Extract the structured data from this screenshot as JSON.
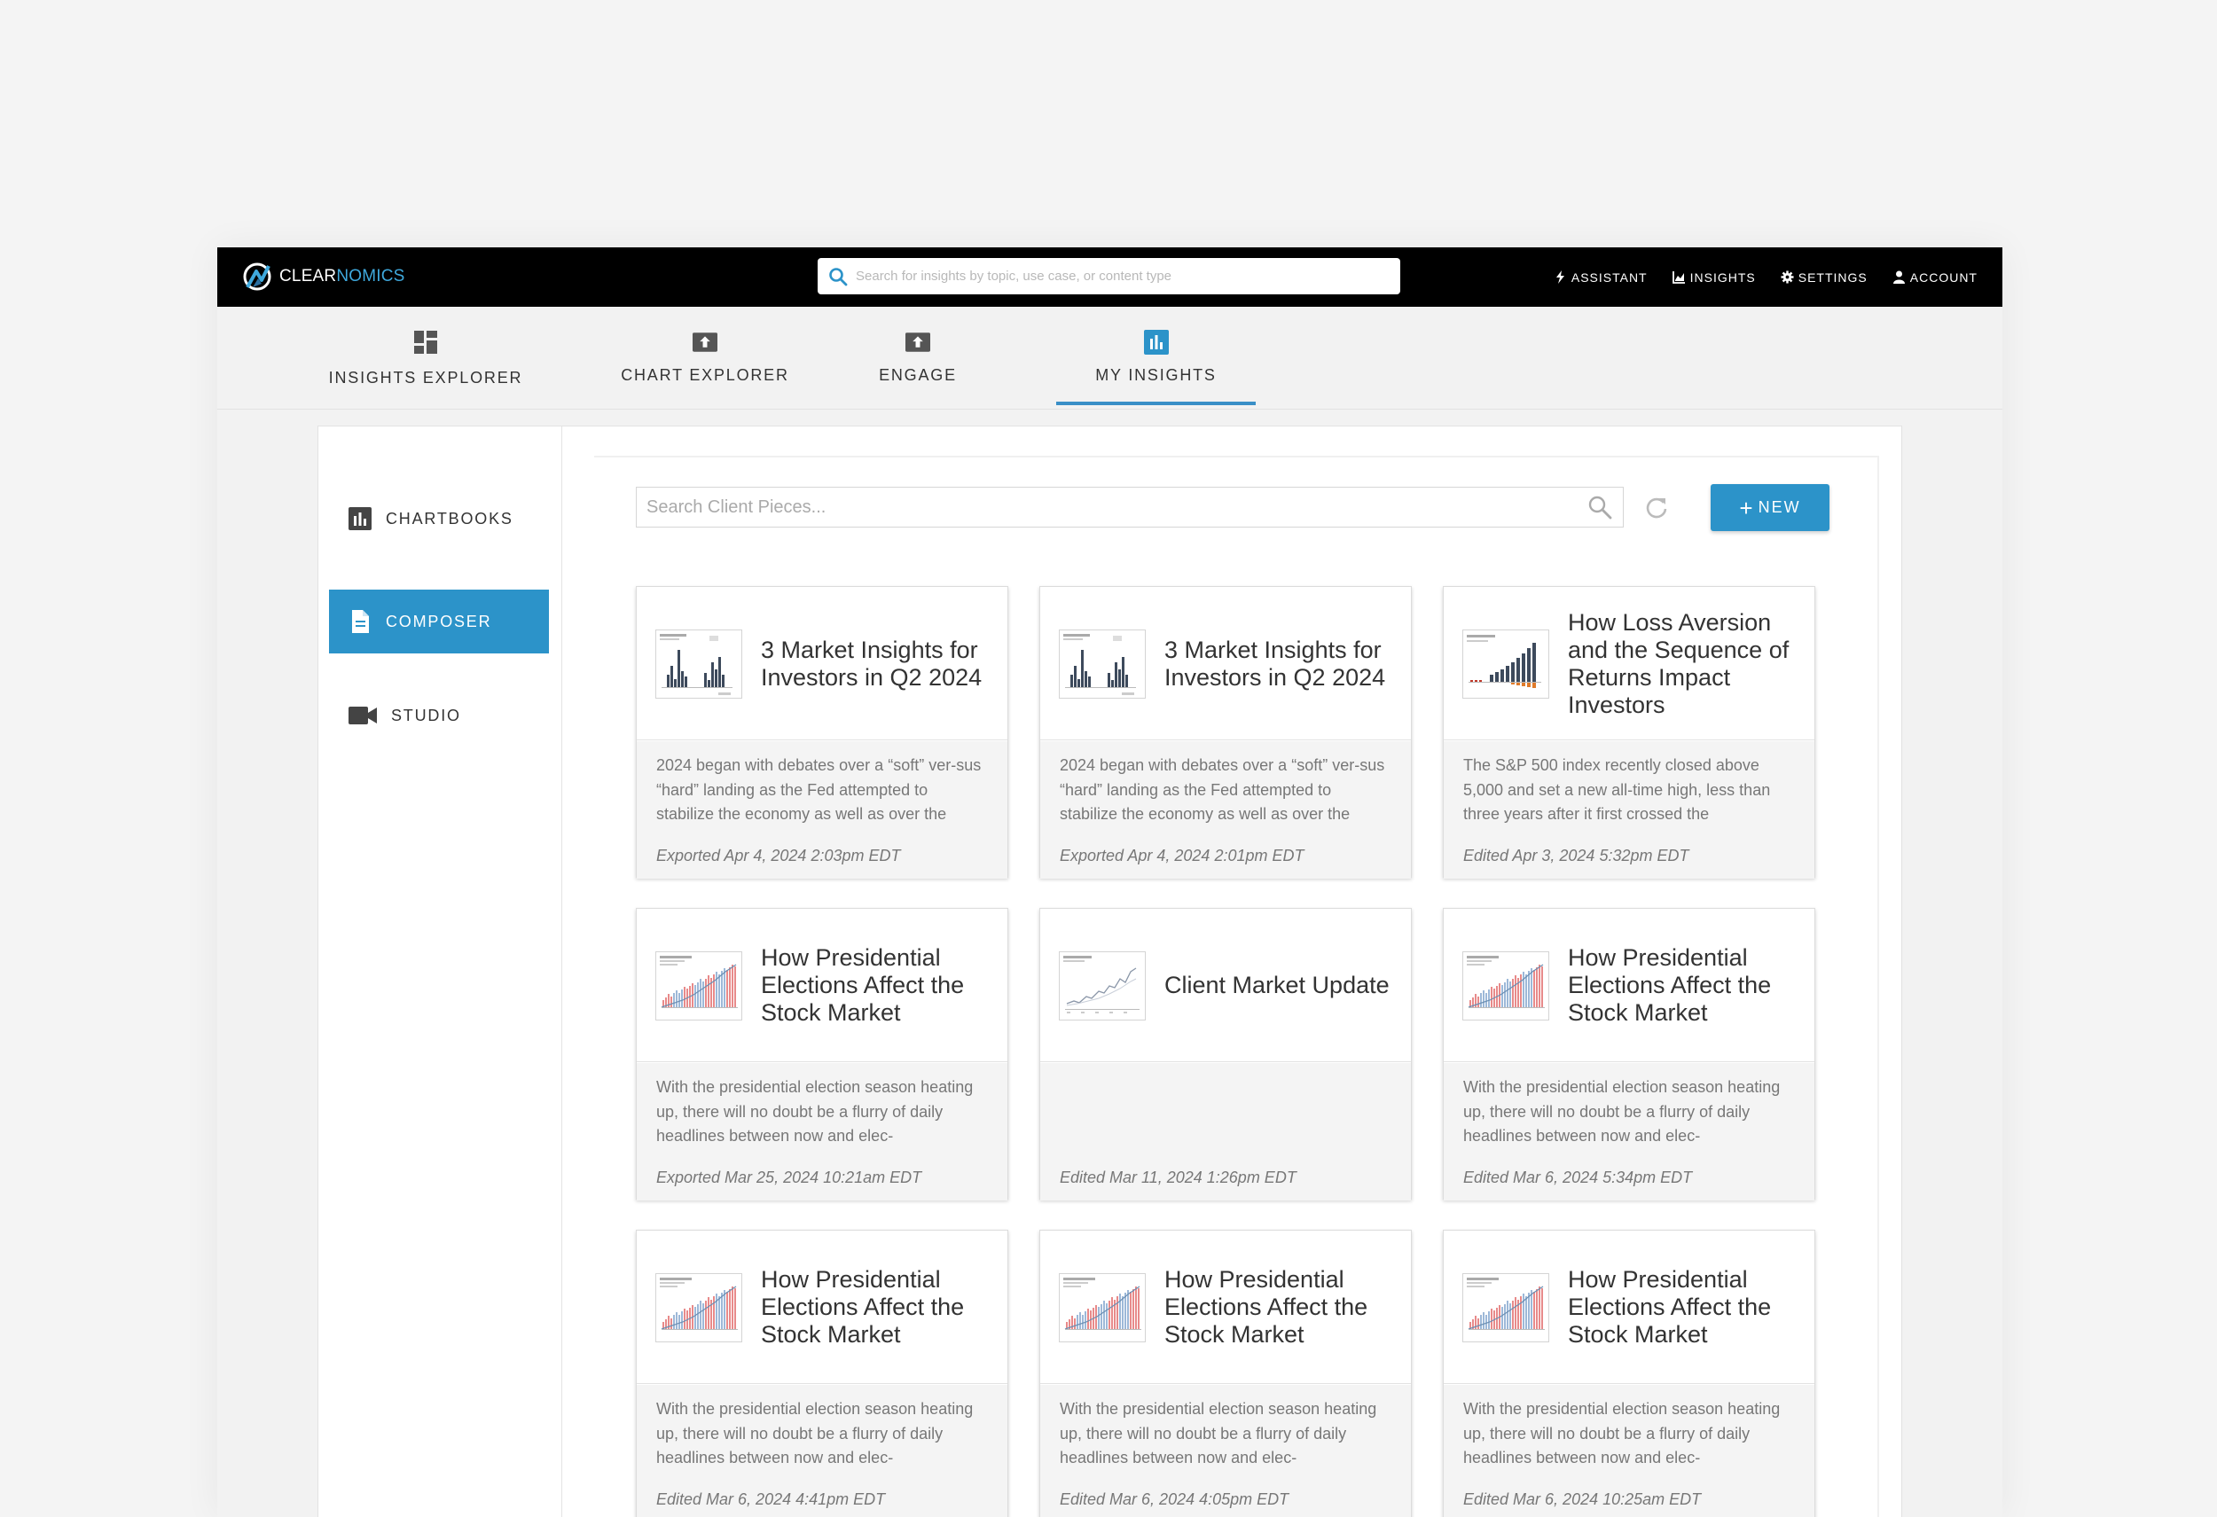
{
  "brand": {
    "part1": "CLEAR",
    "part2": "NOMICS",
    "accent": "#3fa9dd"
  },
  "top_search": {
    "placeholder": "Search for insights by topic, use case, or content type"
  },
  "top_nav": {
    "assistant": "ASSISTANT",
    "insights": "INSIGHTS",
    "settings": "SETTINGS",
    "account": "ACCOUNT"
  },
  "modules": {
    "insights_explorer": "INSIGHTS EXPLORER",
    "chart_explorer": "CHART EXPLORER",
    "engage": "ENGAGE",
    "my_insights": "MY INSIGHTS",
    "active": "MY INSIGHTS"
  },
  "sidebar": {
    "chartbooks": "CHARTBOOKS",
    "composer": "COMPOSER",
    "studio": "STUDIO",
    "active": "COMPOSER"
  },
  "content": {
    "search_placeholder": "Search Client Pieces...",
    "new_label": "NEW"
  },
  "cards": [
    {
      "title": "3 Market Insights for Investors in Q2 2024",
      "desc": "2024 began with debates over a “soft” ver-sus “hard” landing as the Fed attempted to stabilize the economy as well as over the",
      "stamp": "Exported Apr 4, 2024 2:03pm EDT",
      "thumb": "bars"
    },
    {
      "title": "3 Market Insights for Investors in Q2 2024",
      "desc": "2024 began with debates over a “soft” ver-sus “hard” landing as the Fed attempted to stabilize the economy as well as over the",
      "stamp": "Exported Apr 4, 2024 2:01pm EDT",
      "thumb": "bars"
    },
    {
      "title": "How Loss Aversion and the Sequence of Returns Impact Investors",
      "desc": "The S&P 500 index recently closed above 5,000 and set a new all-time high, less than three years after it first crossed the",
      "stamp": "Edited Apr 3, 2024 5:32pm EDT",
      "thumb": "growth"
    },
    {
      "title": "How Presidential Elections Affect the Stock Market",
      "desc": "With the presidential election season heating up, there will no doubt be a flurry of daily headlines between now and elec-",
      "stamp": "Exported Mar 25, 2024 10:21am EDT",
      "thumb": "election"
    },
    {
      "title": "Client Market Update",
      "desc": "",
      "stamp": "Edited Mar 11, 2024 1:26pm EDT",
      "thumb": "line"
    },
    {
      "title": "How Presidential Elections Affect the Stock Market",
      "desc": "With the presidential election season heating up, there will no doubt be a flurry of daily headlines between now and elec-",
      "stamp": "Edited Mar 6, 2024 5:34pm EDT",
      "thumb": "election"
    },
    {
      "title": "How Presidential Elections Affect the Stock Market",
      "desc": "With the presidential election season heating up, there will no doubt be a flurry of daily headlines between now and elec-",
      "stamp": "Edited Mar 6, 2024 4:41pm EDT",
      "thumb": "election"
    },
    {
      "title": "How Presidential Elections Affect the Stock Market",
      "desc": "With the presidential election season heating up, there will no doubt be a flurry of daily headlines between now and elec-",
      "stamp": "Edited Mar 6, 2024 4:05pm EDT",
      "thumb": "election"
    },
    {
      "title": "How Presidential Elections Affect the Stock Market",
      "desc": "With the presidential election season heating up, there will no doubt be a flurry of daily headlines between now and elec-",
      "stamp": "Edited Mar 6, 2024 10:25am EDT",
      "thumb": "election"
    }
  ]
}
